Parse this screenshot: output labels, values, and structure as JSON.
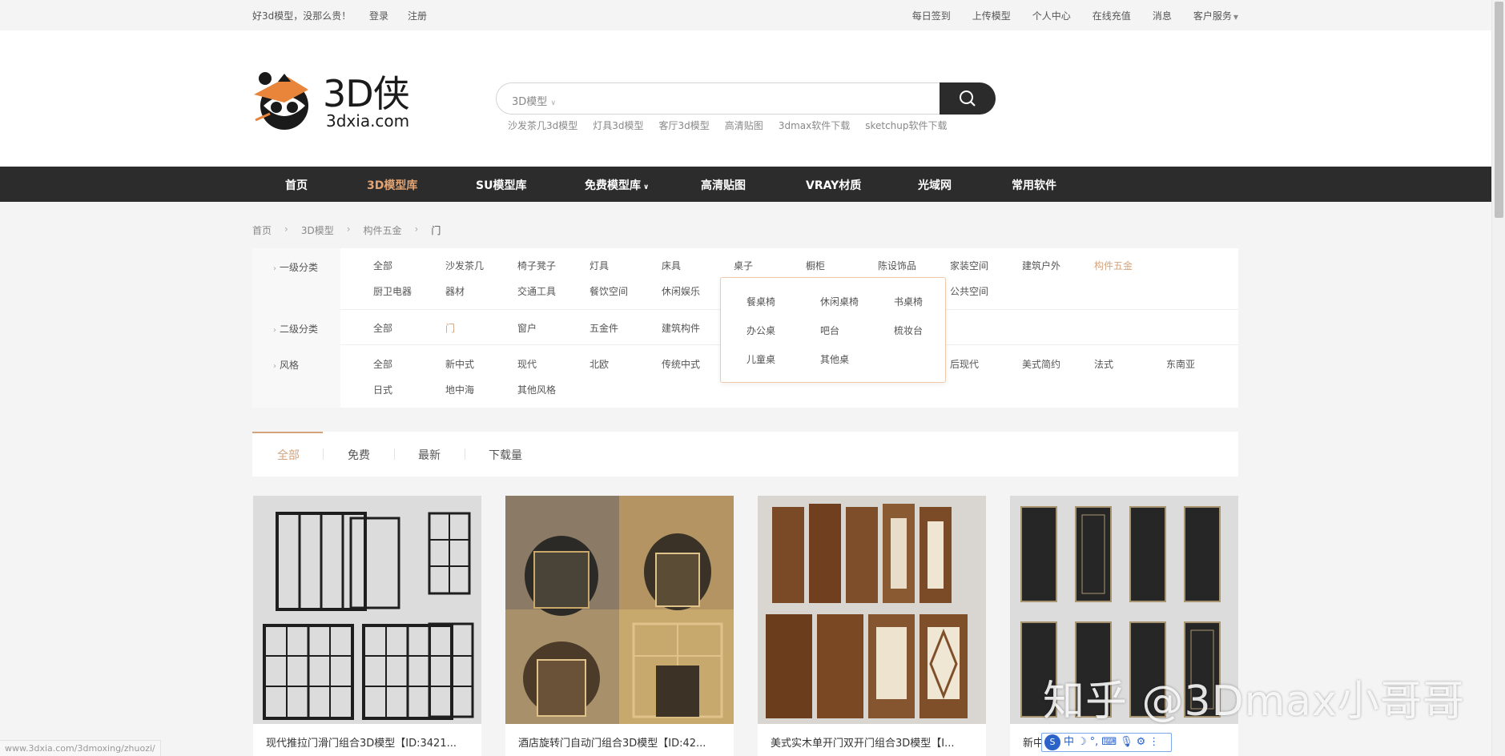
{
  "topbar": {
    "slogan": "好3d模型，没那么贵！",
    "login": "登录",
    "register": "注册",
    "links": [
      "每日签到",
      "上传模型",
      "个人中心",
      "在线充值",
      "消息",
      "客户服务"
    ]
  },
  "logo": {
    "cn": "3D侠",
    "en": "3dxia.com"
  },
  "search": {
    "placeholder": "3D模型",
    "hotwords": [
      "沙发茶几3d模型",
      "灯具3d模型",
      "客厅3d模型",
      "高清贴图",
      "3dmax软件下载",
      "sketchup软件下载"
    ]
  },
  "nav": [
    "首页",
    "3D模型库",
    "SU模型库",
    "免费模型库",
    "高清贴图",
    "VRAY材质",
    "光域网",
    "常用软件"
  ],
  "breadcrumb": [
    "首页",
    "3D模型",
    "构件五金",
    "门"
  ],
  "filter": {
    "level1_label": "一级分类",
    "level1": [
      "全部",
      "沙发茶几",
      "椅子凳子",
      "灯具",
      "床具",
      "桌子",
      "橱柜",
      "陈设饰品",
      "家装空间",
      "建筑户外",
      "构件五金",
      "厨卫电器",
      "器材",
      "交通工具",
      "餐饮空间",
      "休闲娱乐",
      "公共空间"
    ],
    "level2_label": "二级分类",
    "level2": [
      "全部",
      "门",
      "窗户",
      "五金件",
      "建筑构件"
    ],
    "style_label": "风格",
    "style": [
      "全部",
      "新中式",
      "现代",
      "北欧",
      "传统中式",
      "后现代",
      "美式简约",
      "法式",
      "东南亚",
      "日式",
      "地中海",
      "其他风格"
    ],
    "dropdown": [
      "餐桌椅",
      "休闲桌椅",
      "书桌椅",
      "办公桌",
      "吧台",
      "梳妆台",
      "儿童桌",
      "其他桌"
    ]
  },
  "tabs": [
    "全部",
    "免费",
    "最新",
    "下载量"
  ],
  "cards": [
    "现代推拉门滑门组合3D模型【ID:3421...",
    "酒店旋转门自动门组合3D模型【ID:42...",
    "美式实木单开门双开门组合3D模型【I...",
    "新中式…332396..."
  ],
  "status_url": "www.3dxia.com/3dmoxing/zhuozi/",
  "watermark": "知乎 @3Dmax小哥哥",
  "ime": [
    "中"
  ],
  "colors": {
    "accent": "#d2a37d",
    "nav_bg": "#2c2c2c",
    "nav_active": "#e3a474"
  }
}
